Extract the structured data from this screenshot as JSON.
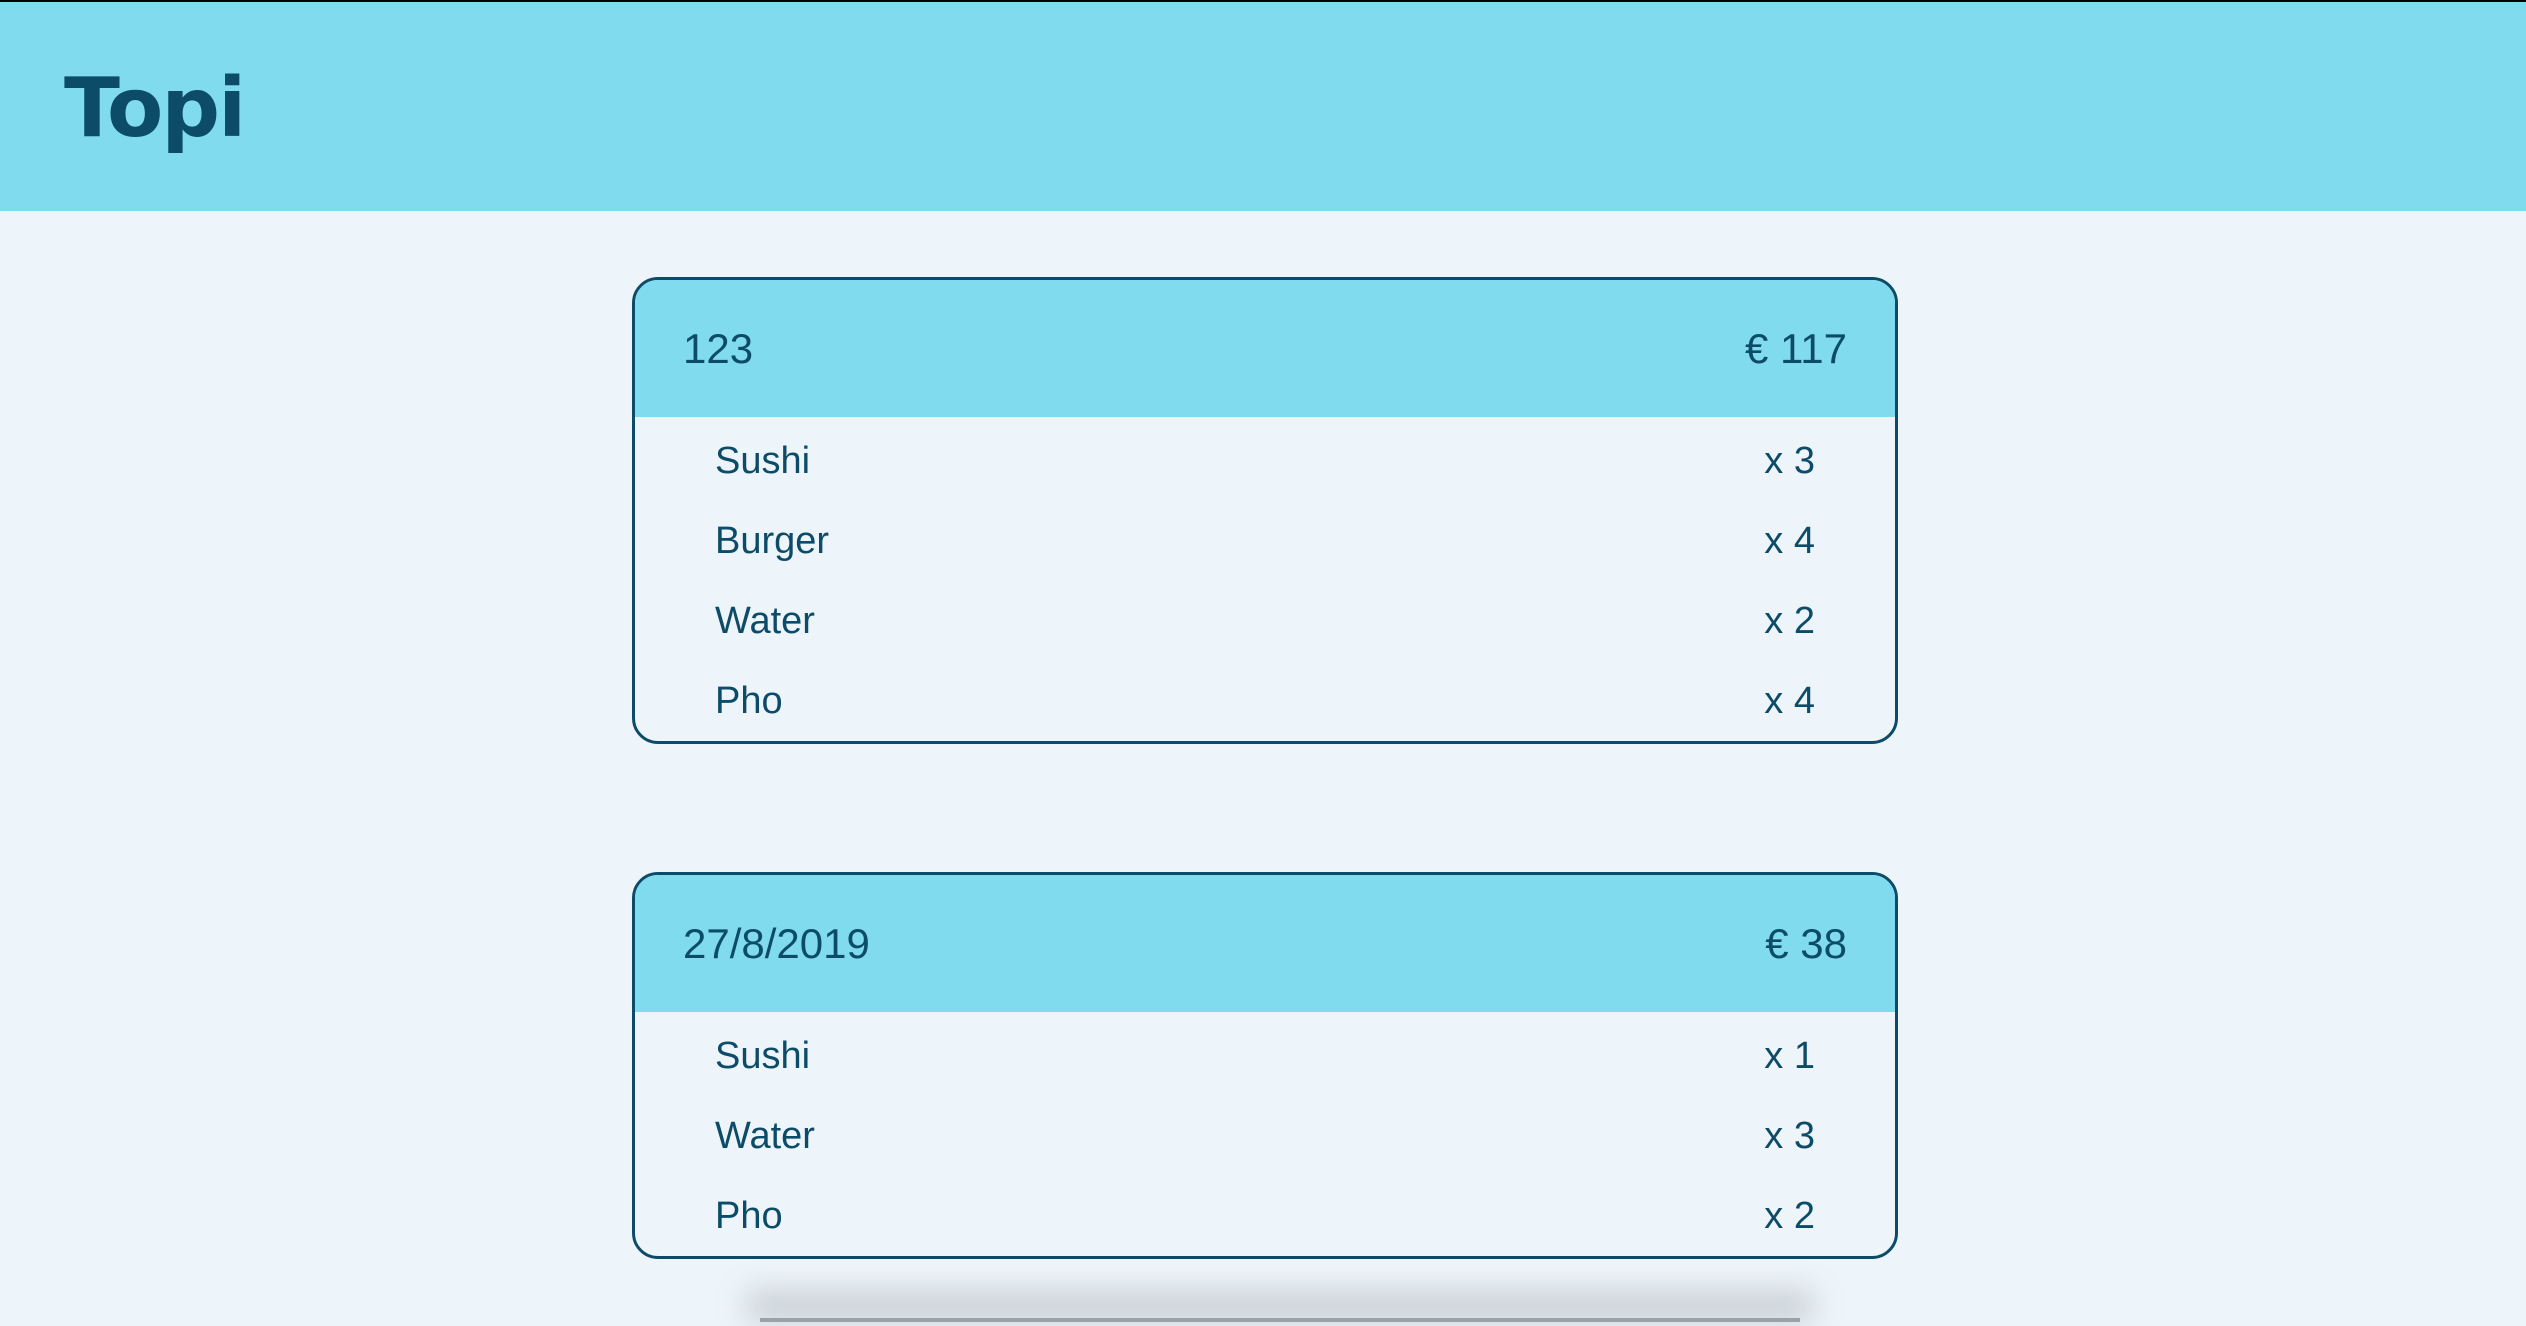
{
  "header": {
    "title": "Topi"
  },
  "orders": [
    {
      "id": "123",
      "total": "€ 117",
      "items": [
        {
          "name": "Sushi",
          "qty": "x 3"
        },
        {
          "name": "Burger",
          "qty": "x 4"
        },
        {
          "name": "Water",
          "qty": "x 2"
        },
        {
          "name": "Pho",
          "qty": "x 4"
        }
      ]
    },
    {
      "id": "27/8/2019",
      "total": "€ 38",
      "items": [
        {
          "name": "Sushi",
          "qty": "x 1"
        },
        {
          "name": "Water",
          "qty": "x 3"
        },
        {
          "name": "Pho",
          "qty": "x 2"
        }
      ]
    }
  ],
  "colors": {
    "header_bg": "#80dbee",
    "page_bg": "#edf4fa",
    "text": "#0c4c68",
    "border": "#0c4c68"
  }
}
